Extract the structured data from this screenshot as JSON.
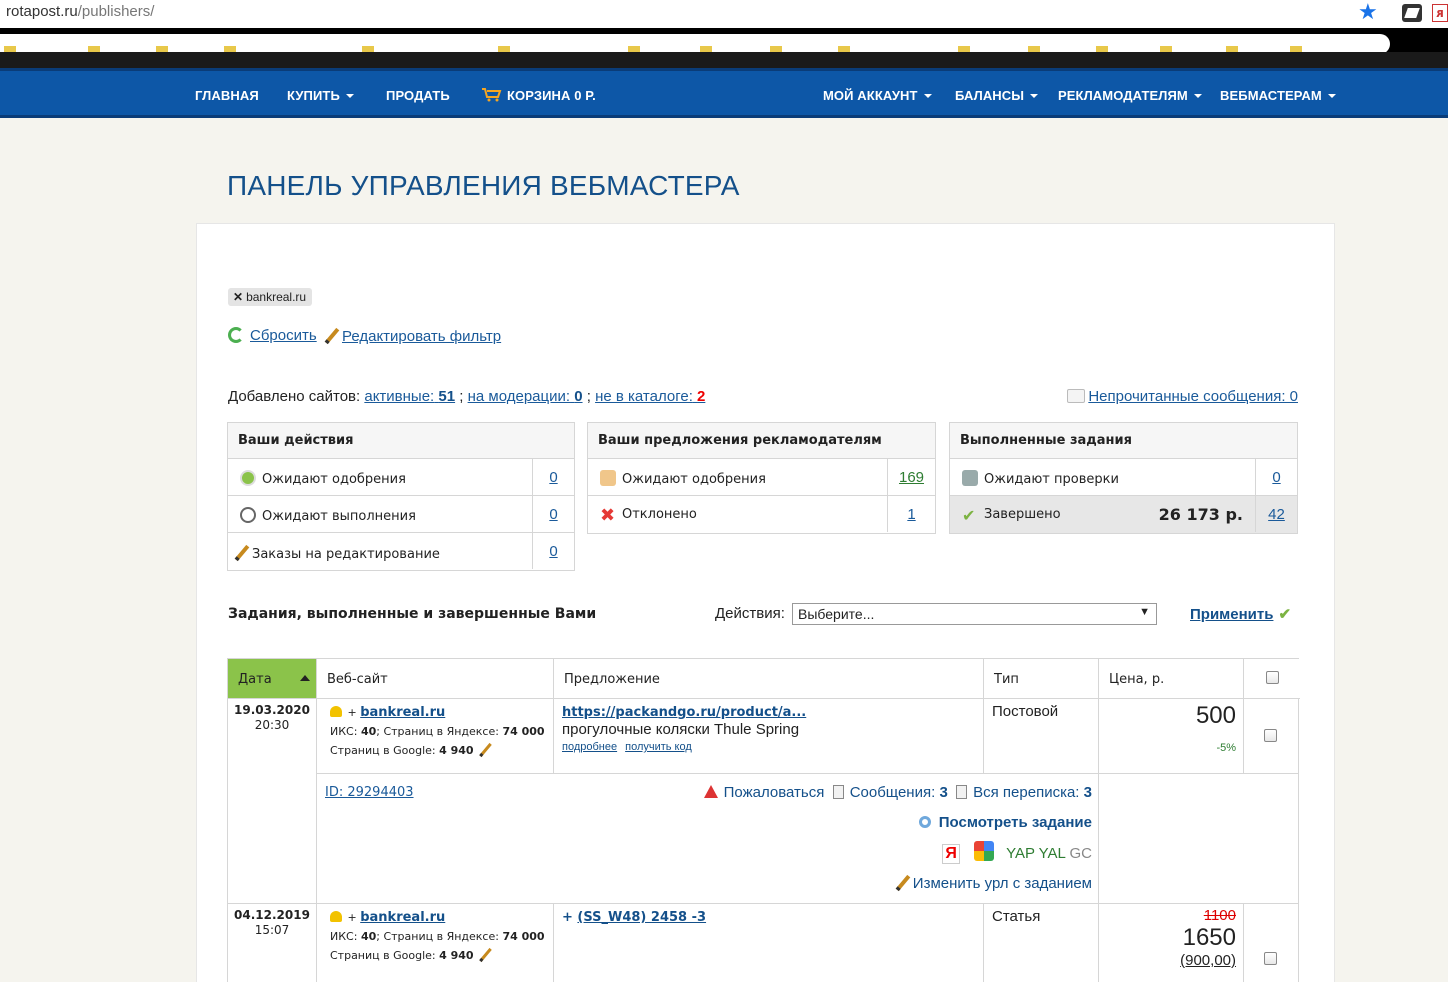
{
  "browser": {
    "url_host": "rotapost.ru",
    "url_path": "/publishers/"
  },
  "nav": {
    "home": "ГЛАВНАЯ",
    "buy": "КУПИТЬ",
    "sell": "ПРОДАТЬ",
    "cart": "КОРЗИНА 0 Р.",
    "account": "МОЙ АККАУНТ",
    "balances": "БАЛАНСЫ",
    "advertisers": "РЕКЛАМОДАТЕЛЯМ",
    "webmasters": "ВЕБМАСТЕРАМ"
  },
  "page_title": "ПАНЕЛЬ УПРАВЛЕНИЯ ВЕБМАСТЕРА",
  "filter": {
    "tag": "bankreal.ru",
    "reset": "Сбросить",
    "edit": "Редактировать фильтр"
  },
  "stats": {
    "prefix": "Добавлено сайтов:",
    "active_label": "активные:",
    "active": "51",
    "moderation_label": "на модерации:",
    "moderation": "0",
    "not_catalog_label": "не в каталоге:",
    "not_catalog": "2",
    "unread": "Непрочитанные сообщения: 0"
  },
  "box_actions": {
    "title": "Ваши действия",
    "rows": [
      {
        "label": "Ожидают одобрения",
        "value": "0"
      },
      {
        "label": "Ожидают выполнения",
        "value": "0"
      },
      {
        "label": "Заказы на редактирование",
        "value": "0"
      }
    ]
  },
  "box_offers": {
    "title": "Ваши предложения рекламодателям",
    "rows": [
      {
        "label": "Ожидают одобрения",
        "value": "169"
      },
      {
        "label": "Отклонено",
        "value": "1"
      }
    ]
  },
  "box_done": {
    "title": "Выполненные задания",
    "rows": [
      {
        "label": "Ожидают проверки",
        "value": "0"
      },
      {
        "label": "Завершено",
        "sum": "26 173 р.",
        "value": "42"
      }
    ]
  },
  "tasks": {
    "title": "Задания, выполненные и завершенные Вами",
    "actions_label": "Действия:",
    "select_value": "Выберите...",
    "apply": "Применить"
  },
  "table": {
    "headers": {
      "date": "Дата",
      "site": "Веб-сайт",
      "offer": "Предложение",
      "type": "Тип",
      "price": "Цена, р."
    },
    "rows": [
      {
        "date": "19.03.2020",
        "time": "20:30",
        "site": "bankreal.ru",
        "iks_label": "ИКС:",
        "iks": "40",
        "yandex_label": "; Страниц в Яндексе:",
        "yandex": "74 000",
        "google_label": "Страниц в Google:",
        "google": "4 940",
        "offer_url": "https://packandgo.ru/product/a...",
        "offer_anchor": "прогулочные коляски Thule Spring",
        "more": "подробнее",
        "get_code": "получить код",
        "type": "Постовой",
        "price": "500",
        "discount": "-5%",
        "id": "ID: 29294403",
        "complain": "Пожаловаться",
        "messages_label": "Сообщения:",
        "messages": "3",
        "all_label": "Вся переписка:",
        "all": "3",
        "view_task": "Посмотреть задание",
        "ya": "Я",
        "yap": "YAP",
        "yal": "YAL",
        "gc": "GC",
        "change_url": "Изменить урл с заданием"
      },
      {
        "date": "04.12.2019",
        "time": "15:07",
        "site": "bankreal.ru",
        "iks_label": "ИКС:",
        "iks": "40",
        "yandex_label": "; Страниц в Яндексе:",
        "yandex": "74 000",
        "google_label": "Страниц в Google:",
        "google": "4 940",
        "offer_title": "(SS_W48) 2458 -3",
        "type": "Статья",
        "old_price": "1100",
        "price": "1650",
        "sub_price": "(900,00)"
      }
    ]
  }
}
